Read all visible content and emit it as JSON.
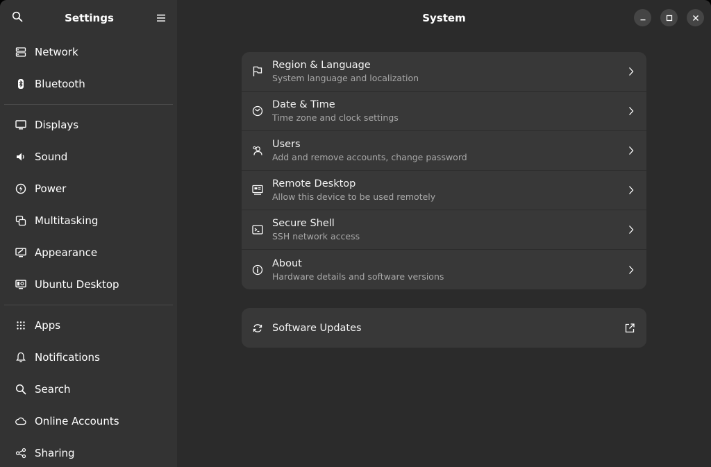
{
  "sidebar": {
    "title": "Settings",
    "search_icon": "search-icon",
    "menu_icon": "hamburger-menu-icon",
    "groups": [
      [
        {
          "label": "Network",
          "icon": "network-icon"
        },
        {
          "label": "Bluetooth",
          "icon": "bluetooth-icon"
        }
      ],
      [
        {
          "label": "Displays",
          "icon": "display-icon"
        },
        {
          "label": "Sound",
          "icon": "speaker-icon"
        },
        {
          "label": "Power",
          "icon": "power-icon"
        },
        {
          "label": "Multitasking",
          "icon": "multitasking-icon"
        },
        {
          "label": "Appearance",
          "icon": "appearance-icon"
        },
        {
          "label": "Ubuntu Desktop",
          "icon": "ubuntu-desktop-icon"
        }
      ],
      [
        {
          "label": "Apps",
          "icon": "apps-grid-icon"
        },
        {
          "label": "Notifications",
          "icon": "bell-icon"
        },
        {
          "label": "Search",
          "icon": "search-icon"
        },
        {
          "label": "Online Accounts",
          "icon": "cloud-icon"
        },
        {
          "label": "Sharing",
          "icon": "share-icon"
        }
      ]
    ]
  },
  "main": {
    "title": "System",
    "window_controls": [
      "minimize-icon",
      "maximize-icon",
      "close-icon"
    ],
    "items": [
      {
        "title": "Region & Language",
        "subtitle": "System language and localization",
        "icon": "flag-icon"
      },
      {
        "title": "Date & Time",
        "subtitle": "Time zone and clock settings",
        "icon": "clock-icon"
      },
      {
        "title": "Users",
        "subtitle": "Add and remove accounts, change password",
        "icon": "users-icon"
      },
      {
        "title": "Remote Desktop",
        "subtitle": "Allow this device to be used remotely",
        "icon": "remote-desktop-icon"
      },
      {
        "title": "Secure Shell",
        "subtitle": "SSH network access",
        "icon": "terminal-icon"
      },
      {
        "title": "About",
        "subtitle": "Hardware details and software versions",
        "icon": "info-icon"
      }
    ],
    "updates": {
      "title": "Software Updates",
      "icon": "refresh-icon",
      "action_icon": "external-link-icon"
    }
  },
  "colors": {
    "sidebar_bg": "#333333",
    "main_bg": "#2b2b2b",
    "card_bg": "#383838",
    "text": "#ffffff",
    "subtext": "#a8a8a8"
  }
}
